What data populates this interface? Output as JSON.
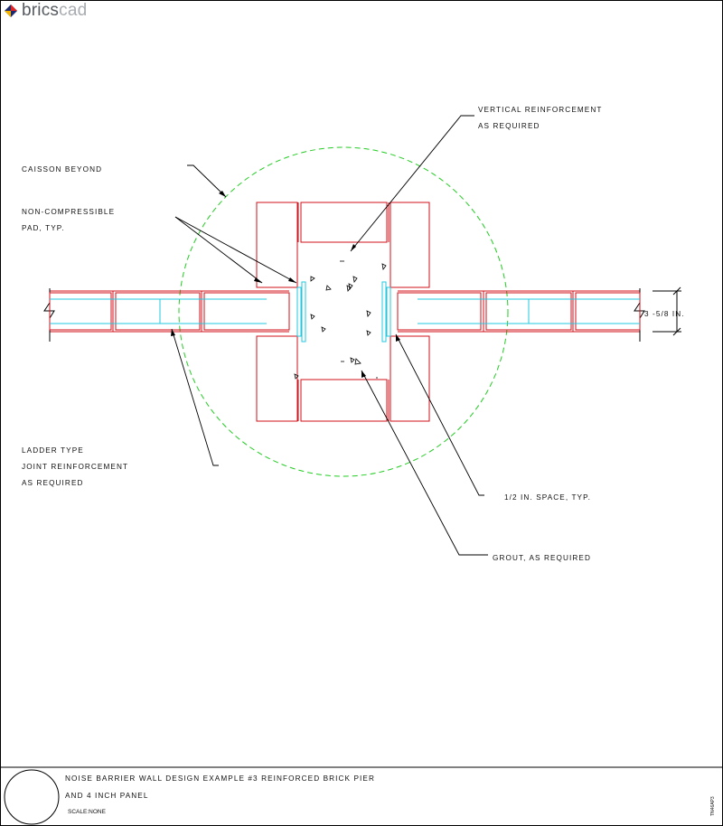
{
  "logo": {
    "part1": "brics",
    "part2": "cad"
  },
  "notes": {
    "vertical_1": "VERTICAL REINFORCEMENT",
    "vertical_2": "AS REQUIRED",
    "caisson": "CAISSON BEYOND",
    "pad_1": "NON-COMPRESSIBLE",
    "pad_2": "PAD, TYP.",
    "ladder_1": "LADDER TYPE",
    "ladder_2": "JOINT REINFORCEMENT",
    "ladder_3": "AS REQUIRED",
    "space": "1/2 IN. SPACE, TYP.",
    "grout": "GROUT, AS REQUIRED",
    "dimension": "3  -5/8 IN."
  },
  "title_block": {
    "line1": "NOISE BARRIER WALL DESIGN EXAMPLE #3 REINFORCED BRICK PIER",
    "line2": "AND 4 INCH PANEL",
    "scale": "SCALE:NONE",
    "id": "TN46AP3"
  },
  "colors": {
    "brick": "#d0101a",
    "reinforcement": "#22c8e0",
    "caisson": "#22cc22",
    "leader": "#000000",
    "text": "#111111"
  }
}
